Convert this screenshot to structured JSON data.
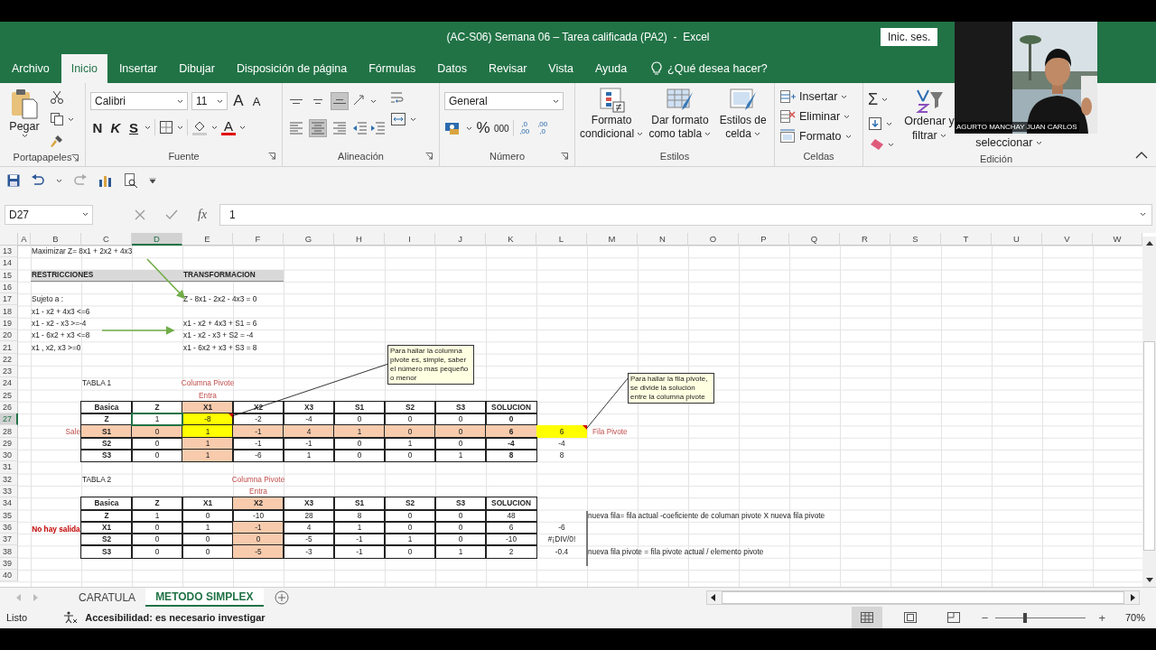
{
  "window": {
    "title": "(AC-S06) Semana 06 – Tarea calificada (PA2)  -  Excel",
    "signin": "Inic. ses."
  },
  "tabs": [
    {
      "label": "Archivo",
      "selected": false
    },
    {
      "label": "Inicio",
      "selected": true
    },
    {
      "label": "Insertar",
      "selected": false
    },
    {
      "label": "Dibujar",
      "selected": false
    },
    {
      "label": "Disposición de página",
      "selected": false
    },
    {
      "label": "Fórmulas",
      "selected": false
    },
    {
      "label": "Datos",
      "selected": false
    },
    {
      "label": "Revisar",
      "selected": false
    },
    {
      "label": "Vista",
      "selected": false
    },
    {
      "label": "Ayuda",
      "selected": false
    }
  ],
  "tell_me": "¿Qué desea hacer?",
  "ribbon": {
    "clipboard": {
      "paste": "Pegar",
      "label": "Portapapeles"
    },
    "font": {
      "name": "Calibri",
      "size": "11",
      "grow": "A",
      "shrink": "A",
      "bold": "N",
      "italic": "K",
      "underline": "S",
      "color_letter": "A",
      "label": "Fuente"
    },
    "alignment": {
      "vertical": [
        {
          "kind": "top",
          "selected": false
        },
        {
          "kind": "middle",
          "selected": false
        },
        {
          "kind": "bottom",
          "selected": true
        }
      ],
      "horizontal": [
        {
          "kind": "left",
          "selected": false
        },
        {
          "kind": "center",
          "selected": true
        },
        {
          "kind": "right",
          "selected": false
        }
      ],
      "label": "Alineación"
    },
    "number": {
      "format": "General",
      "percent": "%",
      "thousands": "000",
      "more_decimals": [
        ",0",
        ",00"
      ],
      "fewer_decimals": [
        ",00",
        ",0"
      ],
      "label": "Número"
    },
    "styles": {
      "buttons": [
        {
          "kind": "conditional",
          "lines": [
            "Formato",
            "condicional"
          ]
        },
        {
          "kind": "table",
          "lines": [
            "Dar formato",
            "como tabla"
          ]
        },
        {
          "kind": "cell",
          "lines": [
            "Estilos de",
            "celda"
          ]
        }
      ],
      "label": "Estilos"
    },
    "cells": {
      "buttons": [
        {
          "kind": "insert",
          "label": "Insertar"
        },
        {
          "kind": "delete",
          "label": "Eliminar"
        },
        {
          "kind": "format",
          "label": "Formato"
        }
      ],
      "label": "Celdas"
    },
    "editing": {
      "sum": "Σ",
      "sort": [
        "Ordenar y",
        "filtrar"
      ],
      "find": [
        "seleccionar"
      ],
      "label": "Edición"
    }
  },
  "webcam": {
    "name": "AGURTO MANCHAY JUAN CARLOS"
  },
  "formula_bar": {
    "name_box": "D27",
    "fx": "fx",
    "value": "1"
  },
  "sheet": {
    "columns": [
      {
        "label": "A",
        "selected": false
      },
      {
        "label": "B",
        "selected": false
      },
      {
        "label": "C",
        "selected": false
      },
      {
        "label": "D",
        "selected": true
      },
      {
        "label": "E",
        "selected": false
      },
      {
        "label": "F",
        "selected": false
      },
      {
        "label": "G",
        "selected": false
      },
      {
        "label": "H",
        "selected": false
      },
      {
        "label": "I",
        "selected": false
      },
      {
        "label": "J",
        "selected": false
      },
      {
        "label": "K",
        "selected": false
      },
      {
        "label": "L",
        "selected": false
      },
      {
        "label": "M",
        "selected": false
      },
      {
        "label": "N",
        "selected": false
      },
      {
        "label": "O",
        "selected": false
      },
      {
        "label": "P",
        "selected": false
      },
      {
        "label": "Q",
        "selected": false
      },
      {
        "label": "R",
        "selected": false
      },
      {
        "label": "S",
        "selected": false
      },
      {
        "label": "T",
        "selected": false
      },
      {
        "label": "U",
        "selected": false
      },
      {
        "label": "V",
        "selected": false
      },
      {
        "label": "W",
        "selected": false
      }
    ],
    "rows": [
      {
        "number": "13",
        "selected": false,
        "cells": {
          "B": {
            "kind": "text",
            "text": "Maximizar Z= 8x1 + 2x2 + 4x3"
          }
        }
      },
      {
        "number": "14",
        "selected": false
      },
      {
        "number": "15",
        "selected": false,
        "cells": {
          "B": {
            "kind": "section",
            "text": "RESTRICCIONES"
          },
          "E": {
            "kind": "section",
            "text": "TRANSFORMACION"
          }
        }
      },
      {
        "number": "16",
        "selected": false
      },
      {
        "number": "17",
        "selected": false,
        "cells": {
          "B": {
            "kind": "text",
            "text": "Sujeto a :"
          },
          "E": {
            "kind": "text",
            "text": "Z - 8x1 - 2x2 - 4x3 = 0"
          }
        }
      },
      {
        "number": "18",
        "selected": false,
        "cells": {
          "B": {
            "kind": "text",
            "text": "x1 - x2 + 4x3 <=6"
          }
        }
      },
      {
        "number": "19",
        "selected": false,
        "cells": {
          "B": {
            "kind": "text",
            "text": "x1 - x2 - x3 >=-4"
          },
          "E": {
            "kind": "text",
            "text": "x1 - x2 + 4x3 + S1 = 6"
          }
        }
      },
      {
        "number": "20",
        "selected": false,
        "cells": {
          "B": {
            "kind": "text",
            "text": "x1 - 6x2 + x3 <=8"
          },
          "E": {
            "kind": "text",
            "text": "x1 - x2 - x3 + S2 = -4"
          }
        }
      },
      {
        "number": "21",
        "selected": false,
        "cells": {
          "B": {
            "kind": "text",
            "text": "x1 , x2, x3 >=0"
          },
          "E": {
            "kind": "text",
            "text": "x1 - 6x2 + x3 + S3 = 8"
          }
        }
      },
      {
        "number": "22",
        "selected": false
      },
      {
        "number": "23",
        "selected": false
      },
      {
        "number": "24",
        "selected": false,
        "cells": {
          "C": {
            "kind": "text",
            "text": "TABLA 1"
          },
          "E": {
            "kind": "caption",
            "text": "Columna Pivote"
          }
        }
      },
      {
        "number": "25",
        "selected": false,
        "cells": {
          "E": {
            "kind": "caption",
            "text": "Entra"
          }
        }
      },
      {
        "number": "26",
        "selected": false,
        "cells": {
          "C": {
            "kind": "head",
            "text": "Basica"
          },
          "D": {
            "kind": "head",
            "text": "Z"
          },
          "E": {
            "kind": "head",
            "text": "X1",
            "color": "#f8cbad"
          },
          "F": {
            "kind": "head",
            "text": "X2"
          },
          "G": {
            "kind": "head",
            "text": "X3"
          },
          "H": {
            "kind": "head",
            "text": "S1"
          },
          "I": {
            "kind": "head",
            "text": "S2"
          },
          "J": {
            "kind": "head",
            "text": "S3"
          },
          "K": {
            "kind": "head",
            "text": "SOLUCION"
          }
        }
      },
      {
        "number": "27",
        "selected": true,
        "cells": {
          "C": {
            "kind": "head",
            "text": "Z"
          },
          "D": {
            "kind": "cell",
            "text": "1"
          },
          "E": {
            "kind": "cell",
            "text": "-8",
            "color": "#ffff00",
            "comment": true
          },
          "F": {
            "kind": "cell",
            "text": "-2"
          },
          "G": {
            "kind": "cell",
            "text": "-4"
          },
          "H": {
            "kind": "cell",
            "text": "0"
          },
          "I": {
            "kind": "cell",
            "text": "0"
          },
          "J": {
            "kind": "cell",
            "text": "0"
          },
          "K": {
            "kind": "head",
            "text": "0"
          }
        }
      },
      {
        "number": "28",
        "selected": false,
        "cells": {
          "B": {
            "kind": "side",
            "text": "Sale"
          },
          "C": {
            "kind": "head",
            "text": "S1",
            "color": "#f8cbad"
          },
          "D": {
            "kind": "cell",
            "text": "0",
            "color": "#f8cbad"
          },
          "E": {
            "kind": "cell",
            "text": "1",
            "color": "#ffff00"
          },
          "F": {
            "kind": "cell",
            "text": "-1",
            "color": "#f8cbad"
          },
          "G": {
            "kind": "cell",
            "text": "4",
            "color": "#f8cbad"
          },
          "H": {
            "kind": "cell",
            "text": "1",
            "color": "#f8cbad"
          },
          "I": {
            "kind": "cell",
            "text": "0",
            "color": "#f8cbad"
          },
          "J": {
            "kind": "cell",
            "text": "0",
            "color": "#f8cbad"
          },
          "K": {
            "kind": "head",
            "text": "6",
            "color": "#f8cbad"
          },
          "L": {
            "kind": "value",
            "text": "6",
            "color": "#ffff00",
            "comment": true
          },
          "M": {
            "kind": "label",
            "text": "Fila Pivote"
          }
        }
      },
      {
        "number": "29",
        "selected": false,
        "cells": {
          "C": {
            "kind": "head",
            "text": "S2"
          },
          "D": {
            "kind": "cell",
            "text": "0"
          },
          "E": {
            "kind": "cell",
            "text": "1",
            "color": "#f8cbad"
          },
          "F": {
            "kind": "cell",
            "text": "-1"
          },
          "G": {
            "kind": "cell",
            "text": "-1"
          },
          "H": {
            "kind": "cell",
            "text": "0"
          },
          "I": {
            "kind": "cell",
            "text": "1"
          },
          "J": {
            "kind": "cell",
            "text": "0"
          },
          "K": {
            "kind": "head",
            "text": "-4"
          },
          "L": {
            "kind": "value",
            "text": "-4"
          }
        }
      },
      {
        "number": "30",
        "selected": false,
        "cells": {
          "C": {
            "kind": "head",
            "text": "S3"
          },
          "D": {
            "kind": "cell",
            "text": "0"
          },
          "E": {
            "kind": "cell",
            "text": "1",
            "color": "#f8cbad"
          },
          "F": {
            "kind": "cell",
            "text": "-6"
          },
          "G": {
            "kind": "cell",
            "text": "1"
          },
          "H": {
            "kind": "cell",
            "text": "0"
          },
          "I": {
            "kind": "cell",
            "text": "0"
          },
          "J": {
            "kind": "cell",
            "text": "1"
          },
          "K": {
            "kind": "head",
            "text": "8"
          },
          "L": {
            "kind": "value",
            "text": "8"
          }
        }
      },
      {
        "number": "31",
        "selected": false
      },
      {
        "number": "32",
        "selected": false,
        "cells": {
          "C": {
            "kind": "text",
            "text": "TABLA 2"
          },
          "F": {
            "kind": "caption",
            "text": "Columna Pivote"
          }
        }
      },
      {
        "number": "33",
        "selected": false,
        "cells": {
          "F": {
            "kind": "caption",
            "text": "Entra"
          }
        }
      },
      {
        "number": "34",
        "selected": false,
        "cells": {
          "C": {
            "kind": "head",
            "text": "Basica"
          },
          "D": {
            "kind": "head",
            "text": "Z"
          },
          "E": {
            "kind": "head",
            "text": "X1"
          },
          "F": {
            "kind": "head",
            "text": "X2",
            "color": "#f8cbad"
          },
          "G": {
            "kind": "head",
            "text": "X3"
          },
          "H": {
            "kind": "head",
            "text": "S1"
          },
          "I": {
            "kind": "head",
            "text": "S2"
          },
          "J": {
            "kind": "head",
            "text": "S3"
          },
          "K": {
            "kind": "head",
            "text": "SOLUCION"
          }
        }
      },
      {
        "number": "35",
        "selected": false,
        "cells": {
          "C": {
            "kind": "head",
            "text": "Z"
          },
          "D": {
            "kind": "cell",
            "text": "1"
          },
          "E": {
            "kind": "cell",
            "text": "0"
          },
          "F": {
            "kind": "cell",
            "text": "-10"
          },
          "G": {
            "kind": "cell",
            "text": "28"
          },
          "H": {
            "kind": "cell",
            "text": "8"
          },
          "I": {
            "kind": "cell",
            "text": "0"
          },
          "J": {
            "kind": "cell",
            "text": "0"
          },
          "K": {
            "kind": "cell",
            "text": "48"
          },
          "M": {
            "kind": "text",
            "text": "nueva fila= fila actual -coeficiente de columan pivote X nueva fila pivote"
          }
        }
      },
      {
        "number": "36",
        "selected": false,
        "cells": {
          "B": {
            "kind": "warn",
            "text": "No hay salida"
          },
          "C": {
            "kind": "head",
            "text": "X1"
          },
          "D": {
            "kind": "cell",
            "text": "0"
          },
          "E": {
            "kind": "cell",
            "text": "1"
          },
          "F": {
            "kind": "cell",
            "text": "-1",
            "color": "#f8cbad"
          },
          "G": {
            "kind": "cell",
            "text": "4"
          },
          "H": {
            "kind": "cell",
            "text": "1"
          },
          "I": {
            "kind": "cell",
            "text": "0"
          },
          "J": {
            "kind": "cell",
            "text": "0"
          },
          "K": {
            "kind": "cell",
            "text": "6"
          },
          "L": {
            "kind": "value",
            "text": "-6"
          }
        }
      },
      {
        "number": "37",
        "selected": false,
        "cells": {
          "C": {
            "kind": "head",
            "text": "S2"
          },
          "D": {
            "kind": "cell",
            "text": "0"
          },
          "E": {
            "kind": "cell",
            "text": "0"
          },
          "F": {
            "kind": "cell",
            "text": "0",
            "color": "#f8cbad"
          },
          "G": {
            "kind": "cell",
            "text": "-5"
          },
          "H": {
            "kind": "cell",
            "text": "-1"
          },
          "I": {
            "kind": "cell",
            "text": "1"
          },
          "J": {
            "kind": "cell",
            "text": "0"
          },
          "K": {
            "kind": "cell",
            "text": "-10"
          },
          "L": {
            "kind": "value",
            "text": "#¡DIV/0!"
          }
        }
      },
      {
        "number": "38",
        "selected": false,
        "cells": {
          "C": {
            "kind": "head",
            "text": "S3"
          },
          "D": {
            "kind": "cell",
            "text": "0"
          },
          "E": {
            "kind": "cell",
            "text": "0"
          },
          "F": {
            "kind": "cell",
            "text": "-5",
            "color": "#f8cbad"
          },
          "G": {
            "kind": "cell",
            "text": "-3"
          },
          "H": {
            "kind": "cell",
            "text": "-1"
          },
          "I": {
            "kind": "cell",
            "text": "0"
          },
          "J": {
            "kind": "cell",
            "text": "1"
          },
          "K": {
            "kind": "cell",
            "text": "2"
          },
          "L": {
            "kind": "value",
            "text": "-0.4"
          },
          "M": {
            "kind": "text",
            "text": "nueva fila pivote = fila pivote actual / elemento pivote"
          }
        }
      },
      {
        "number": "39",
        "selected": false
      },
      {
        "number": "40",
        "selected": false
      }
    ]
  },
  "comments": [
    {
      "text": "Para hallar la columna pivote es, simple, saber el número mas pequeño o menor"
    },
    {
      "text": "Para hallar la fila pivote, se divide la solución entre la columna pivote"
    }
  ],
  "sheet_tabs": [
    {
      "label": "CARATULA",
      "selected": false
    },
    {
      "label": "METODO SIMPLEX",
      "selected": true
    }
  ],
  "status_bar": {
    "ready": "Listo",
    "accessibility": "Accesibilidad: es necesario investigar",
    "views": [
      {
        "kind": "normal",
        "selected": true
      },
      {
        "kind": "layout",
        "selected": false
      },
      {
        "kind": "pagebreak",
        "selected": false
      }
    ],
    "zoom": {
      "out": "−",
      "in": "+",
      "level": 0.33,
      "reading": "70%"
    }
  }
}
